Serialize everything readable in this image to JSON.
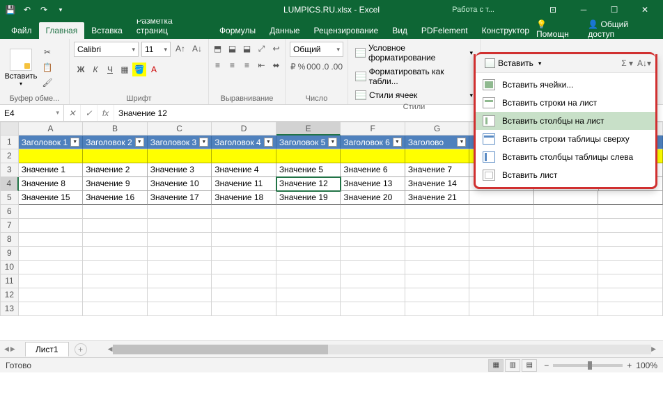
{
  "title": "LUMPICS.RU.xlsx - Excel",
  "tools_label": "Работа с т...",
  "tabs": [
    "Файл",
    "Главная",
    "Вставка",
    "Разметка страниц",
    "Формулы",
    "Данные",
    "Рецензирование",
    "Вид",
    "PDFelement",
    "Конструктор"
  ],
  "active_tab": 1,
  "help": {
    "help": "Помощн",
    "share": "Общий доступ"
  },
  "clipboard": {
    "label": "Буфер обме...",
    "paste": "Вставить"
  },
  "font": {
    "label": "Шрифт",
    "name": "Calibri",
    "size": "11"
  },
  "alignment": {
    "label": "Выравнивание"
  },
  "number": {
    "label": "Число",
    "format": "Общий"
  },
  "styles": {
    "label": "Стили",
    "cond": "Условное форматирование",
    "table": "Форматировать как табли...",
    "cell": "Стили ячеек"
  },
  "dropdown": {
    "insert": "Вставить",
    "items": [
      {
        "t": "Вставить ячейки...",
        "ic": "cells"
      },
      {
        "t": "Вставить строки на лист",
        "ic": "rows"
      },
      {
        "t": "Вставить столбцы на лист",
        "ic": "cols",
        "hl": true
      },
      {
        "t": "Вставить строки таблицы сверху",
        "ic": "trows"
      },
      {
        "t": "Вставить столбцы таблицы слева",
        "ic": "tcols"
      },
      {
        "t": "Вставить лист",
        "ic": "sheet-ic"
      }
    ]
  },
  "namebox": "E4",
  "formula": "Значение 12",
  "cols": [
    "A",
    "B",
    "C",
    "D",
    "E",
    "F",
    "G",
    "",
    "",
    ""
  ],
  "rownums": [
    "1",
    "2",
    "3",
    "4",
    "5",
    "6",
    "7",
    "8",
    "9",
    "10",
    "11",
    "12",
    "13"
  ],
  "headers": [
    "Заголовок 1",
    "Заголовок 2",
    "Заголовок 3",
    "Заголовок 4",
    "Заголовок 5",
    "Заголовок 6",
    "Заголово"
  ],
  "data": [
    [
      "Значение 1",
      "Значение 2",
      "Значение 3",
      "Значение 4",
      "Значение 5",
      "Значение 6",
      "Значение 7"
    ],
    [
      "Значение 8",
      "Значение 9",
      "Значение 10",
      "Значение 11",
      "Значение 12",
      "Значение 13",
      "Значение 14"
    ],
    [
      "Значение 15",
      "Значение 16",
      "Значение 17",
      "Значение 18",
      "Значение 19",
      "Значение 20",
      "Значение 21"
    ]
  ],
  "sheet_tab": "Лист1",
  "status": "Готово",
  "zoom": "100%"
}
